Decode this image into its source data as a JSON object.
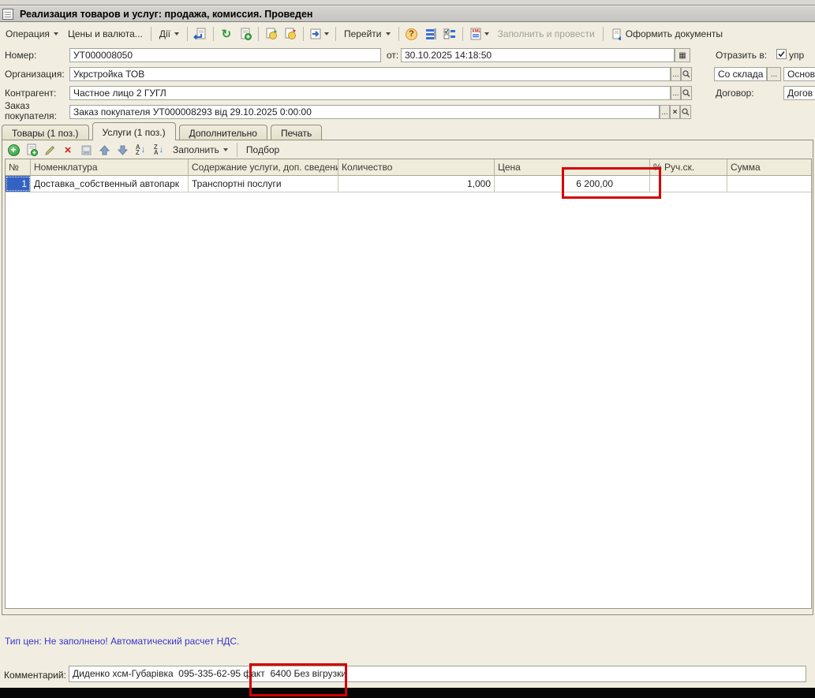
{
  "window": {
    "title": "Реализация товаров и услуг: продажа, комиссия. Проведен"
  },
  "toolbar": {
    "operation_label": "Операция",
    "prices_label": "Цены и валюта...",
    "actions_label": "Дії",
    "goto_label": "Перейти",
    "fill_post_label": "Заполнить и провести",
    "make_docs_label": "Оформить документы",
    "icons": [
      "post-document-icon",
      "refresh-icon",
      "new-copy-icon",
      "money-in-icon",
      "money-out-icon",
      "export-document-icon",
      "help-icon",
      "list-settings-icon",
      "list-columns-icon",
      "xml-exchange-icon",
      "make-documents-icon"
    ]
  },
  "form": {
    "number_label": "Номер:",
    "number_value": "УТ000008050",
    "date_label": "от:",
    "date_value": "30.10.2025 14:18:50",
    "org_label": "Организация:",
    "org_value": "Укрстройка ТОВ",
    "contractor_label": "Контрагент:",
    "contractor_value": "Частное лицо 2 ГУГЛ",
    "order_label_line1": "Заказ",
    "order_label_line2": "покупателя:",
    "order_value": "Заказ покупателя УТ000008293 від 29.10.2025 0:00:00",
    "ellipsis_button": "...",
    "clear_button": "×",
    "reflect_label": "Отразить в:",
    "reflect_checkbox_label": "упр",
    "warehouse_value": "Со склада",
    "warehouse_account_value": "Основ",
    "contract_label": "Договор:",
    "contract_value": "Догов"
  },
  "tabs": [
    {
      "label": "Товары (1 поз.)"
    },
    {
      "label": "Услуги (1 поз.)"
    },
    {
      "label": "Дополнительно"
    },
    {
      "label": "Печать"
    }
  ],
  "table_toolbar": {
    "fill_label": "Заполнить",
    "pick_label": "Подбор",
    "icons": [
      "add-icon",
      "copy-icon",
      "edit-icon",
      "delete-icon",
      "finish-edit-icon",
      "move-up-icon",
      "move-down-icon",
      "sort-asc-icon",
      "sort-desc-icon"
    ]
  },
  "table": {
    "columns": [
      "№",
      "Номенклатура",
      "Содержание услуги, доп. сведения",
      "Количество",
      "Цена",
      "% Руч.ск.",
      "Сумма"
    ],
    "rows": [
      {
        "num": "1",
        "nomenclature": "Доставка_собственный автопарк",
        "service": "Транспортні послуги",
        "qty": "1,000",
        "price": "6 200,00",
        "manual_discount": "",
        "sum": ""
      }
    ]
  },
  "footer": {
    "price_type_notice": "Тип цен: Не заполнено! Автоматический расчет НДС.",
    "comment_label": "Комментарий:",
    "comment_value": "Диденко хсм-Губарівка  095-335-62-95 факт  6400 Без вігрузки"
  },
  "annotations": {
    "highlight_color": "#d40000",
    "highlighted_price": "6 200,00",
    "highlighted_comment": "6400 Без вігрузки"
  },
  "colors": {
    "background": "#f1eee1",
    "selected_cell": "#3462c0",
    "notice_text": "#3535cd",
    "title_bar": "#cdcbc7"
  }
}
